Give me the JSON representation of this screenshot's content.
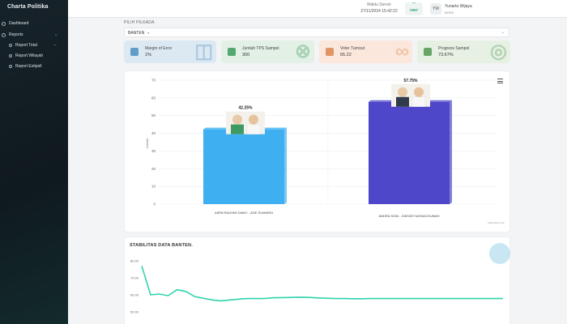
{
  "app": {
    "brand": "Charta Politika"
  },
  "sidebar": {
    "items": [
      {
        "label": "Dashboard"
      },
      {
        "label": "Reports"
      },
      {
        "label": "Report Total"
      },
      {
        "label": "Report Wilayah"
      },
      {
        "label": "Report Exitpoll"
      }
    ]
  },
  "header": {
    "server_label": "Waktu Server",
    "server_time": "27/11/2024 15:42:22",
    "counter_value": "#557",
    "avatar_initials": "YW",
    "user_name": "Yunarto Wijaya",
    "user_role": "BOSS"
  },
  "filter": {
    "label": "PILIH PILKADA",
    "selected": "BANTEN"
  },
  "cards": [
    {
      "title": "Margin of Error",
      "value": "1%",
      "color": "#dde9f2",
      "icon_color": "#4a90c2",
      "icon": "info-icon"
    },
    {
      "title": "Jumlah TPS Sampel",
      "value": "300",
      "color": "#e3f0e6",
      "icon_color": "#3a9a5c",
      "icon": "tower-icon"
    },
    {
      "title": "Voter Turnout",
      "value": "65.22",
      "color": "#fbe7dc",
      "icon_color": "#d9874f",
      "icon": "people-icon"
    },
    {
      "title": "Progress Sampel",
      "value": "73.67%",
      "color": "#e6f1e4",
      "icon_color": "#4f9a52",
      "icon": "progress-icon"
    }
  ],
  "chart_data": [
    {
      "type": "bar",
      "categories": [
        "AIRIN RACHMI DIANY - ADE SUMARDI",
        "ANDRA SONI - DIMYATI NATAKUSUMAH"
      ],
      "values": [
        42.25,
        57.75
      ],
      "data_labels": [
        "42.25%",
        "57.75%"
      ],
      "colors": [
        "#3eb0f2",
        "#4e47c9"
      ],
      "ylabel": "Jumlah",
      "ylim": [
        0,
        70
      ],
      "yticks": [
        0,
        10,
        20,
        30,
        40,
        50,
        60,
        70
      ],
      "grid": true,
      "credit": "Highcharts.com"
    },
    {
      "type": "line",
      "title": "STABILITAS DATA BANTEN.",
      "ylim": [
        50,
        80
      ],
      "yticks": [
        "80.00",
        "70.00",
        "60.00",
        "50.00"
      ],
      "color": "#2fd3ad",
      "values": [
        77,
        60,
        60.5,
        59.5,
        63,
        62,
        59,
        58,
        57,
        56.5,
        57,
        57.5,
        57.8,
        57.8,
        57.9,
        58.3,
        58.4,
        58.5,
        58.6,
        58.5,
        58.2,
        58.0,
        57.8,
        57.8,
        57.7,
        57.7,
        57.8,
        57.8,
        57.8,
        57.8,
        57.8,
        57.8,
        57.8,
        57.8,
        57.8,
        57.8,
        57.8,
        57.8,
        57.8,
        57.8,
        57.8,
        57.8
      ]
    }
  ]
}
